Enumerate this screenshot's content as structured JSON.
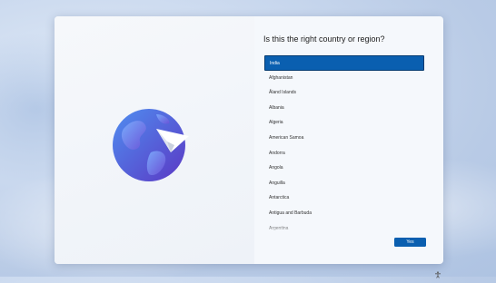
{
  "page": {
    "title": "Is this the right country or region?"
  },
  "countries": {
    "selected_index": 0,
    "items": [
      "India",
      "Afghanistan",
      "Åland Islands",
      "Albania",
      "Algeria",
      "American Samoa",
      "Andorra",
      "Angola",
      "Anguilla",
      "Antarctica",
      "Antigua and Barbuda",
      "Argentina"
    ]
  },
  "actions": {
    "yes_label": "Yes"
  },
  "colors": {
    "accent": "#0a5fb0",
    "globe_light": "#4c79e6",
    "globe_dark": "#5a3fc9"
  },
  "icons": {
    "hero": "globe-with-paper-plane-icon",
    "tray": "accessibility-icon"
  }
}
